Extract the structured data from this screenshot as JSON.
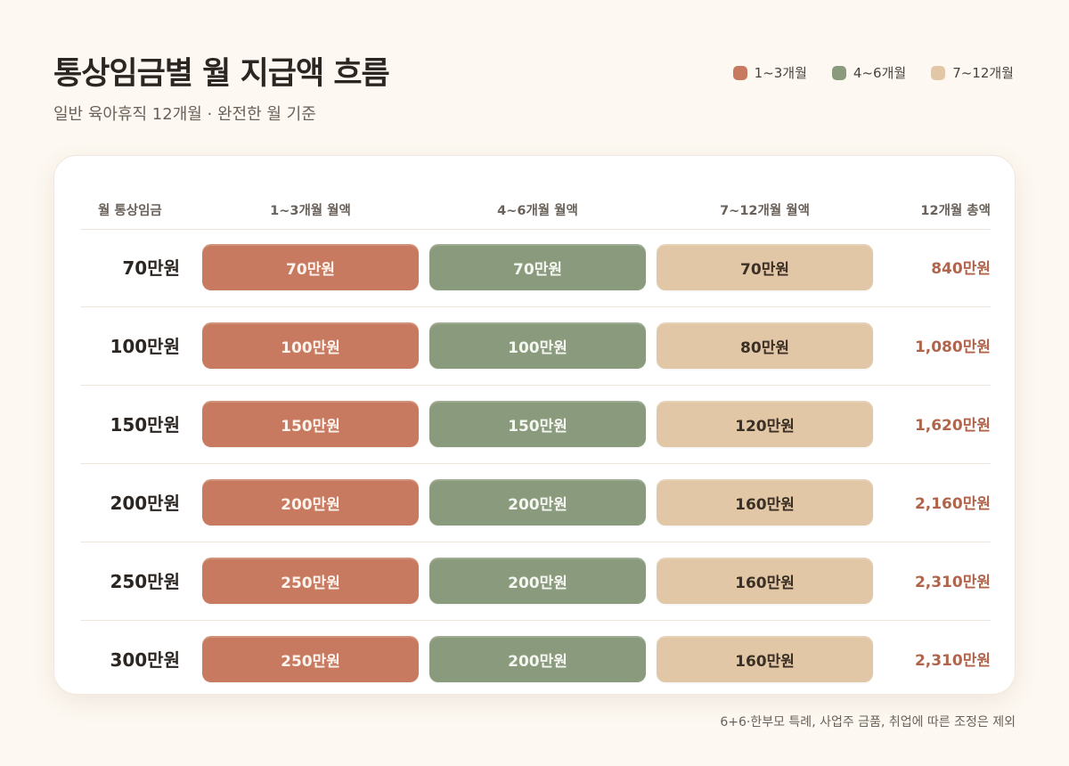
{
  "title": "통상임금별 월 지급액 흐름",
  "subtitle": "일반 육아휴직 12개월 · 완전한 월 기준",
  "legend": [
    {
      "label": "1~3개월",
      "color": "#c77a5f"
    },
    {
      "label": "4~6개월",
      "color": "#8a9a7c"
    },
    {
      "label": "7~12개월",
      "color": "#e2c7a7"
    }
  ],
  "columns": [
    "월 통상임금",
    "1~3개월 월액",
    "4~6개월 월액",
    "7~12개월 월액",
    "12개월 총액"
  ],
  "footnote": "6+6·한부모 특례, 사업주 금품, 취업에 따른 조정은 제외",
  "chart_data": {
    "type": "table",
    "title": "통상임금별 월 지급액 흐름",
    "subtitle": "일반 육아휴직 12개월 · 완전한 월 기준",
    "unit": "만원",
    "categories": [
      "70만원",
      "100만원",
      "150만원",
      "200만원",
      "250만원",
      "300만원"
    ],
    "series": [
      {
        "name": "1~3개월",
        "values": [
          70,
          100,
          150,
          200,
          250,
          250
        ]
      },
      {
        "name": "4~6개월",
        "values": [
          70,
          100,
          150,
          200,
          200,
          200
        ]
      },
      {
        "name": "7~12개월",
        "values": [
          70,
          80,
          120,
          160,
          160,
          160
        ]
      }
    ],
    "rows": [
      {
        "wage": "70만원",
        "m1": "70만원",
        "m2": "70만원",
        "m3": "70만원",
        "total": "840만원"
      },
      {
        "wage": "100만원",
        "m1": "100만원",
        "m2": "100만원",
        "m3": "80만원",
        "total": "1,080만원"
      },
      {
        "wage": "150만원",
        "m1": "150만원",
        "m2": "150만원",
        "m3": "120만원",
        "total": "1,620만원"
      },
      {
        "wage": "200만원",
        "m1": "200만원",
        "m2": "200만원",
        "m3": "160만원",
        "total": "2,160만원"
      },
      {
        "wage": "250만원",
        "m1": "250만원",
        "m2": "200만원",
        "m3": "160만원",
        "total": "2,310만원"
      },
      {
        "wage": "300만원",
        "m1": "250만원",
        "m2": "200만원",
        "m3": "160만원",
        "total": "2,310만원"
      }
    ],
    "totals": [
      840,
      1080,
      1620,
      2160,
      2310,
      2310
    ],
    "legend_position": "top-right"
  }
}
